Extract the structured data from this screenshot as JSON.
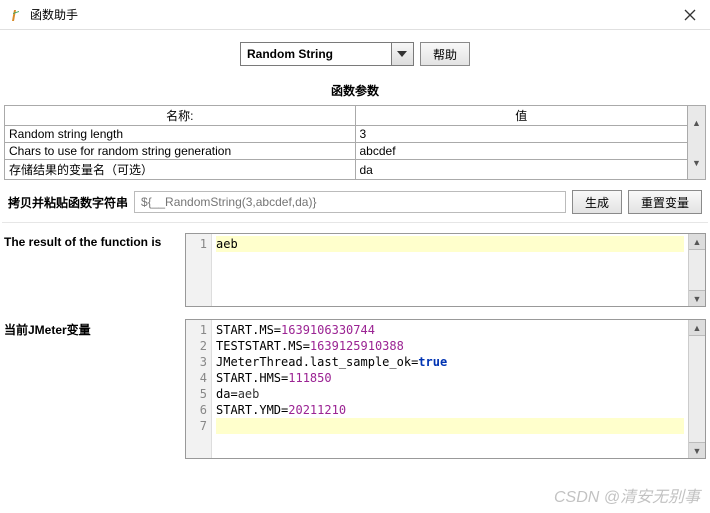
{
  "window": {
    "title": "函数助手"
  },
  "top": {
    "combo_value": "Random String",
    "help_btn": "帮助"
  },
  "params": {
    "heading": "函数参数",
    "col_name": "名称:",
    "col_value": "值",
    "rows": [
      {
        "name": "Random string length",
        "value": "3"
      },
      {
        "name": "Chars to use for random string generation",
        "value": "abcdef"
      },
      {
        "name": "存储结果的变量名（可选）",
        "value": "da"
      }
    ]
  },
  "copy": {
    "label": "拷贝并粘贴函数字符串",
    "placeholder": "${__RandomString(3,abcdef,da)}",
    "gen_btn": "生成",
    "reset_btn": "重置变量"
  },
  "result": {
    "label": "The result of the function is",
    "value": "aeb"
  },
  "vars": {
    "label": "当前JMeter变量",
    "lines": [
      {
        "k": "START.MS",
        "v": "1639106330744",
        "t": "num"
      },
      {
        "k": "TESTSTART.MS",
        "v": "1639125910388",
        "t": "num"
      },
      {
        "k": "JMeterThread.last_sample_ok",
        "v": "true",
        "t": "kw"
      },
      {
        "k": "START.HMS",
        "v": "111850",
        "t": "num"
      },
      {
        "k": "da",
        "v": "aeb",
        "t": "var"
      },
      {
        "k": "START.YMD",
        "v": "20211210",
        "t": "num"
      }
    ]
  },
  "watermark": "CSDN @清安无别事"
}
